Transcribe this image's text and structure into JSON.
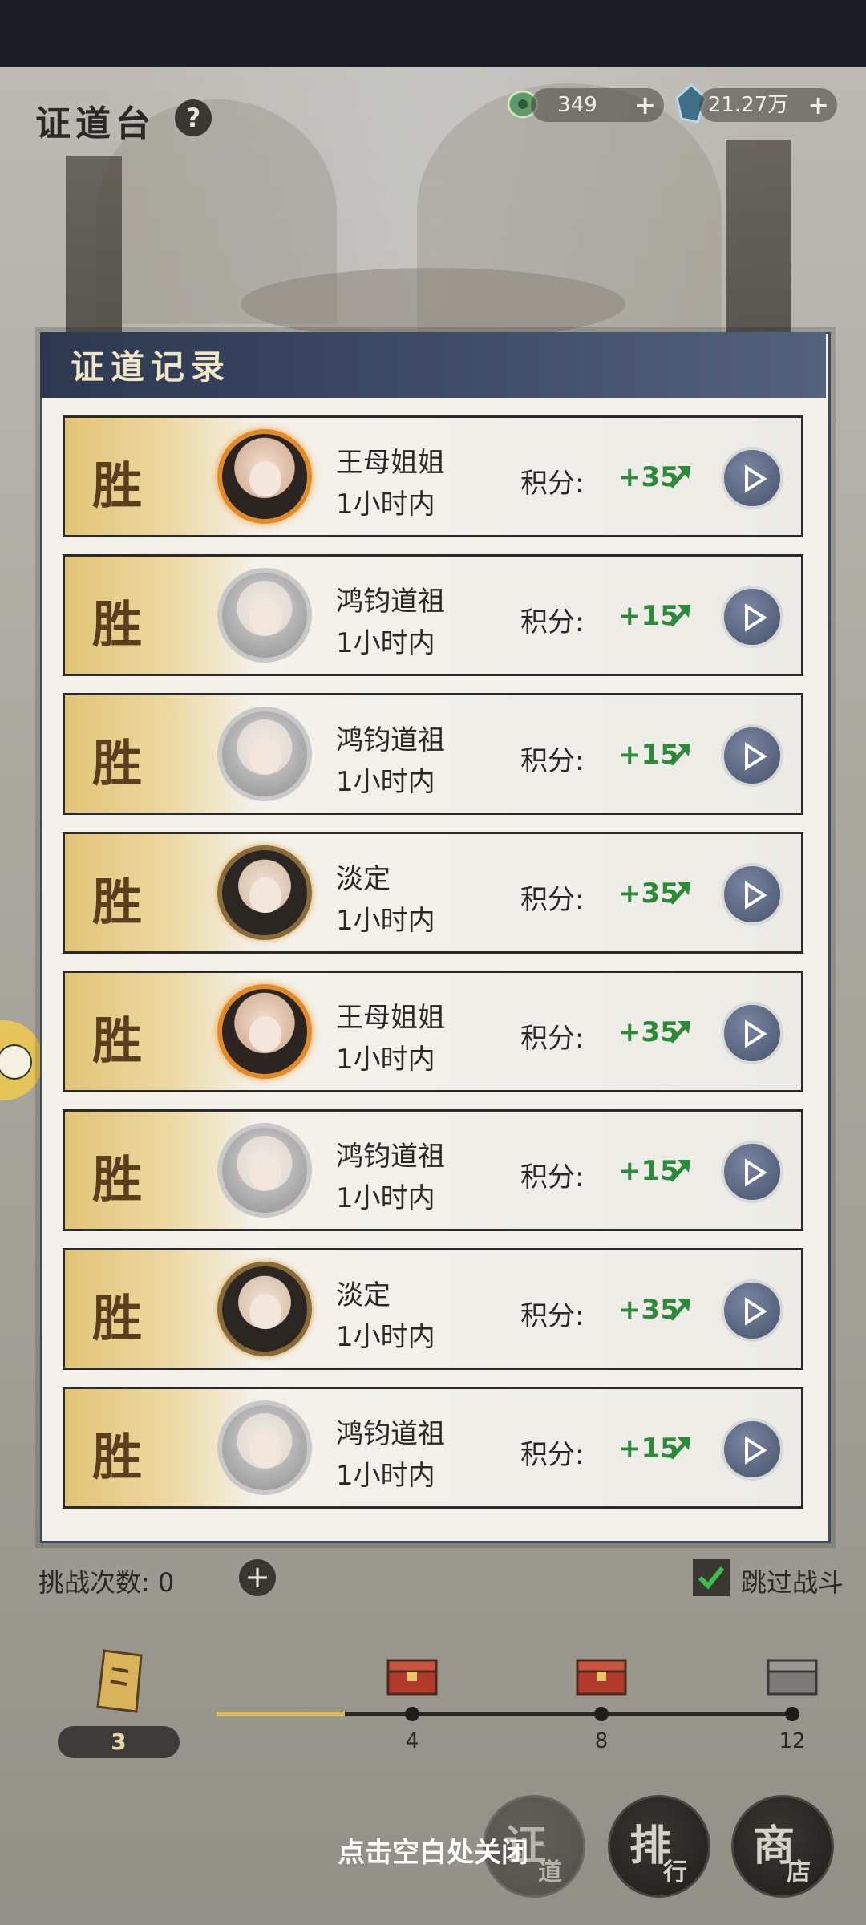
{
  "header": {
    "title": "证道台",
    "help_icon": "question-icon",
    "resources": [
      {
        "icon": "jade-coin-icon",
        "value": "349",
        "plus": "+"
      },
      {
        "icon": "spirit-stone-icon",
        "value": "21.27万",
        "plus": "+"
      }
    ]
  },
  "panel": {
    "title": "证道记录",
    "score_label": "积分:",
    "records": [
      {
        "result": "胜",
        "name": "王母姐姐",
        "time": "1小时内",
        "score": "+35",
        "avatar": "gold"
      },
      {
        "result": "胜",
        "name": "鸿钧道祖",
        "time": "1小时内",
        "score": "+15",
        "avatar": "silver"
      },
      {
        "result": "胜",
        "name": "鸿钧道祖",
        "time": "1小时内",
        "score": "+15",
        "avatar": "silver"
      },
      {
        "result": "胜",
        "name": "淡定",
        "time": "1小时内",
        "score": "+35",
        "avatar": "bronze"
      },
      {
        "result": "胜",
        "name": "王母姐姐",
        "time": "1小时内",
        "score": "+35",
        "avatar": "gold"
      },
      {
        "result": "胜",
        "name": "鸿钧道祖",
        "time": "1小时内",
        "score": "+15",
        "avatar": "silver"
      },
      {
        "result": "胜",
        "name": "淡定",
        "time": "1小时内",
        "score": "+35",
        "avatar": "bronze"
      },
      {
        "result": "胜",
        "name": "鸿钧道祖",
        "time": "1小时内",
        "score": "+15",
        "avatar": "silver"
      }
    ]
  },
  "bottom": {
    "challenge_label": "挑战次数: 0",
    "add_symbol": "+",
    "skip_label": "跳过战斗",
    "token_count": "3",
    "milestones": [
      "4",
      "8",
      "12"
    ],
    "close_hint": "点击空白处关闭"
  },
  "nav": [
    {
      "big": "证",
      "small": "道"
    },
    {
      "big": "排",
      "small": "行"
    },
    {
      "big": "商",
      "small": "店"
    }
  ],
  "colors": {
    "score_green": "#2c8a3a",
    "panel_header": "#2d3850",
    "win_band": "#e2c477"
  }
}
